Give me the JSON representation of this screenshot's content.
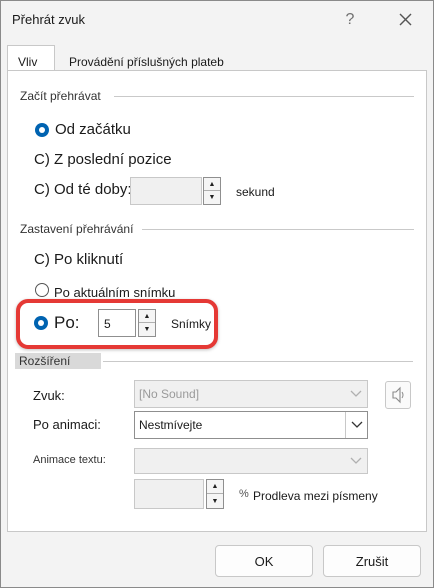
{
  "dialog": {
    "title": "Přehrát zvuk",
    "help_label": "?",
    "tabs": [
      {
        "label": "Vliv",
        "active": true
      },
      {
        "label": "Provádění příslušných plateb",
        "active": false
      }
    ]
  },
  "start": {
    "section_label": "Začít přehrávat",
    "option_beginning": "Od začátku",
    "option_last_position": "C) Z poslední pozice",
    "option_from_time": "C) Od té doby:",
    "from_time_value": "",
    "from_time_unit": "sekund",
    "selected": "Od začátku"
  },
  "stop": {
    "section_label": "Zastavení přehrávání",
    "option_on_click": "C) Po kliknutí",
    "option_after_current": "Po aktuálním snímku",
    "option_after": "Po:",
    "after_value": "5",
    "after_unit": "Snímky",
    "selected": "Po:"
  },
  "enhancements": {
    "section_label": "Rozšíření",
    "sound_label": "Zvuk:",
    "sound_value": "[No Sound]",
    "after_animation_label": "Po animaci:",
    "after_animation_value": "Nestmívejte",
    "animate_text_label": "Animace textu:",
    "animate_text_value": "",
    "delay_value": "",
    "delay_percent": "%",
    "delay_label": "Prodleva mezi písmeny"
  },
  "buttons": {
    "ok": "OK",
    "cancel": "Zrušit"
  },
  "colors": {
    "radio_selected": "#0063b1",
    "highlight_border": "#e53935"
  }
}
